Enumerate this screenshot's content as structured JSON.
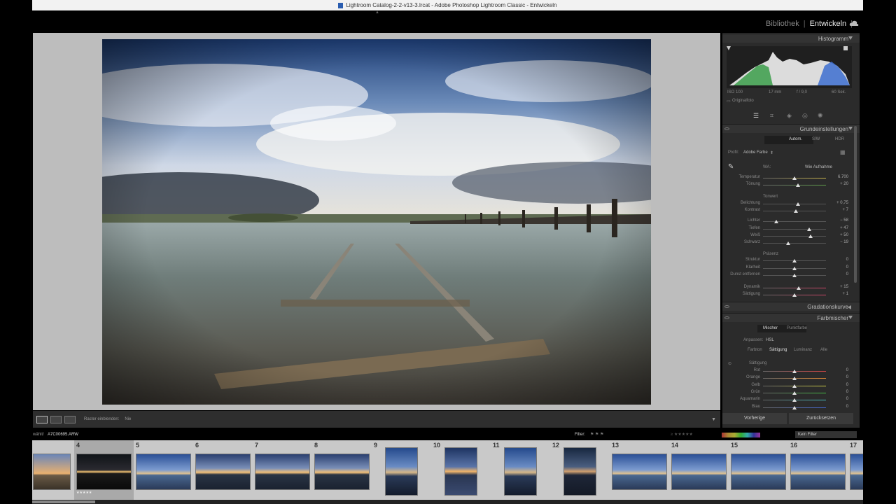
{
  "window": {
    "title": "Lightroom Catalog-2-2-v13-3.lrcat - Adobe Photoshop Lightroom Classic - Entwickeln"
  },
  "modules": {
    "library": "Bibliothek",
    "develop": "Entwickeln",
    "separator": "|"
  },
  "histogram": {
    "title": "Histogramm",
    "iso": "ISO 100",
    "focal": "17 mm",
    "aperture": "f / 9,0",
    "shutter": "60 Sek.",
    "original_label": "Originalfoto"
  },
  "basic": {
    "title": "Grundeinstellungen",
    "treatment": [
      "Autom.",
      "S/W",
      "HDR"
    ],
    "profile_label": "Profil:",
    "profile_value": "Adobe Farbe",
    "wb_label": "WA:",
    "wb_value": "Wie Aufnahme",
    "wb_sliders": [
      {
        "label": "Temperatur",
        "value": "6.700",
        "pos": 0.5
      },
      {
        "label": "Tönung",
        "value": "+ 20",
        "pos": 0.56
      }
    ],
    "tone_title": "Tonwert",
    "tone_sliders": [
      {
        "label": "Belichtung",
        "value": "+ 0,75",
        "pos": 0.56
      },
      {
        "label": "Kontrast",
        "value": "+ 7",
        "pos": 0.52
      },
      {
        "label": "Lichter",
        "value": "− 58",
        "pos": 0.21
      },
      {
        "label": "Tiefen",
        "value": "+ 47",
        "pos": 0.73
      },
      {
        "label": "Weiß",
        "value": "+ 50",
        "pos": 0.75
      },
      {
        "label": "Schwarz",
        "value": "− 19",
        "pos": 0.4
      }
    ],
    "presence_title": "Präsenz",
    "presence_sliders": [
      {
        "label": "Struktur",
        "value": "0",
        "pos": 0.5
      },
      {
        "label": "Klarheit",
        "value": "0",
        "pos": 0.5
      },
      {
        "label": "Dunst entfernen",
        "value": "0",
        "pos": 0.5
      },
      {
        "label": "Dynamik",
        "value": "+ 15",
        "pos": 0.57
      },
      {
        "label": "Sättigung",
        "value": "+ 1",
        "pos": 0.5
      }
    ]
  },
  "tonecurve": {
    "title": "Gradationskurve"
  },
  "colormixer": {
    "title": "Farbmischer",
    "tabs": [
      "Mischer",
      "Punktfarbe"
    ],
    "adjust_label": "Anpassen:",
    "adjust_value": "HSL",
    "subtabs": [
      "Farbton",
      "Sättigung",
      "Luminanz",
      "Alle"
    ],
    "section_title": "Sättigung",
    "sliders": [
      {
        "label": "Rot",
        "value": "0",
        "color": "#c44"
      },
      {
        "label": "Orange",
        "value": "0",
        "color": "#d83"
      },
      {
        "label": "Gelb",
        "value": "0",
        "color": "#cc4"
      },
      {
        "label": "Grün",
        "value": "0",
        "color": "#4b4"
      },
      {
        "label": "Aquamarin",
        "value": "0",
        "color": "#4bb"
      },
      {
        "label": "Blau",
        "value": "0",
        "color": "#46c"
      }
    ]
  },
  "footer_buttons": {
    "prev": "Vorherige",
    "reset": "Zurücksetzen"
  },
  "toolbar": {
    "grid_label": "Raster einblenden:",
    "grid_value": "Nie"
  },
  "filterbar": {
    "source": "wählt/",
    "filename": "A7C00695.ARW",
    "filter_label": "Filter:",
    "filter_value": "Kein Filter"
  },
  "filmstrip": [
    {
      "num": "",
      "kind": "landscape-warm"
    },
    {
      "num": "4",
      "kind": "dark-sunset",
      "stars": "★★★★★"
    },
    {
      "num": "5",
      "kind": "landscape-blue"
    },
    {
      "num": "6",
      "kind": "landscape-sunset"
    },
    {
      "num": "7",
      "kind": "landscape-sunset"
    },
    {
      "num": "8",
      "kind": "landscape-sunset"
    },
    {
      "num": "9",
      "kind": "portrait-blue"
    },
    {
      "num": "10",
      "kind": "portrait-sunset"
    },
    {
      "num": "11",
      "kind": "portrait-blue"
    },
    {
      "num": "12",
      "kind": "portrait-dark"
    },
    {
      "num": "13",
      "kind": "landscape-blue"
    },
    {
      "num": "14",
      "kind": "landscape-blue"
    },
    {
      "num": "15",
      "kind": "landscape-blue"
    },
    {
      "num": "16",
      "kind": "landscape-blue"
    },
    {
      "num": "17",
      "kind": "landscape-blue"
    }
  ]
}
